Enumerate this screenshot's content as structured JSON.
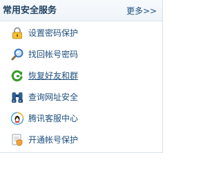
{
  "panel": {
    "title": "常用安全服务",
    "more_label": "更多>>"
  },
  "items": [
    {
      "label": "设置密码保护",
      "icon": "lock-icon",
      "underlined": false
    },
    {
      "label": "找回帐号密码",
      "icon": "search-icon",
      "underlined": false
    },
    {
      "label": "恢复好友和群",
      "icon": "restore-icon",
      "underlined": true
    },
    {
      "label": "查询网址安全",
      "icon": "binoculars-icon",
      "underlined": false
    },
    {
      "label": "腾讯客服中心",
      "icon": "qq-penguin-icon",
      "underlined": false
    },
    {
      "label": "开通帐号保护",
      "icon": "shield-document-icon",
      "underlined": false
    }
  ],
  "colors": {
    "title": "#1f3f5e",
    "link": "#1e4f7c",
    "border": "#d7e1ea"
  }
}
